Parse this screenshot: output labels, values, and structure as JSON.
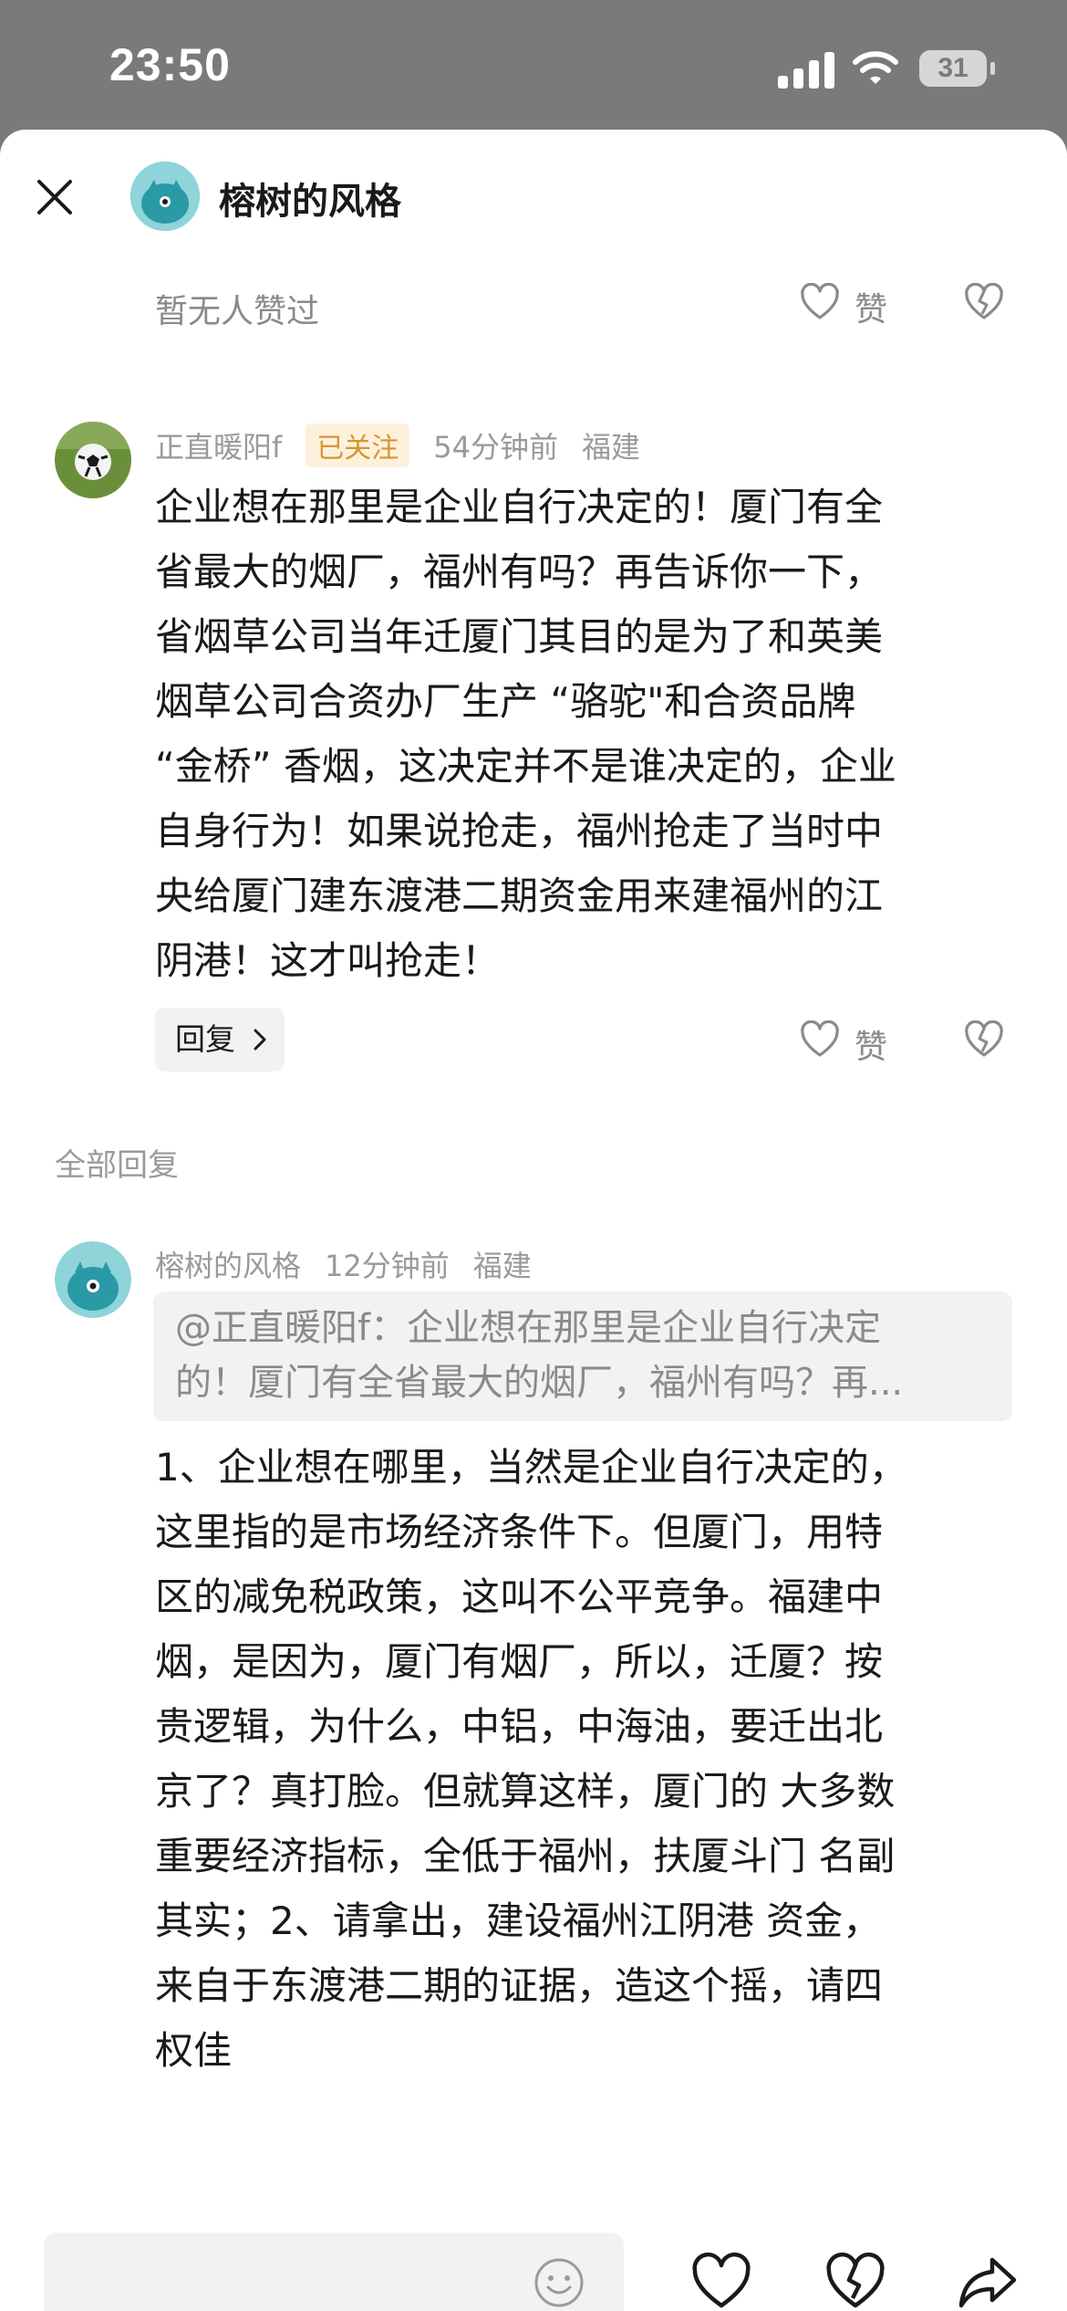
{
  "status_bar": {
    "time": "23:50",
    "battery": "31"
  },
  "header": {
    "title": "榕树的风格"
  },
  "likes_row": {
    "text": "暂无人赞过",
    "like_label": "赞"
  },
  "comment": {
    "username": "正直暖阳f",
    "follow_badge": "已关注",
    "time": "54分钟前",
    "location": "福建",
    "lines": [
      "企业想在那里是企业自行决定的！厦门有全",
      "省最大的烟厂，福州有吗？再告诉你一下，",
      "省烟草公司当年迁厦门其目的是为了和英美",
      "烟草公司合资办厂生产 “骆驼\"和合资品牌",
      "“金桥” 香烟，这决定并不是谁决定的，企业",
      "自身行为！如果说抢走，福州抢走了当时中",
      "央给厦门建东渡港二期资金用来建福州的江",
      "阴港！这才叫抢走！"
    ],
    "reply_label": "回复",
    "like_label": "赞"
  },
  "all_replies_label": "全部回复",
  "reply": {
    "username": "榕树的风格",
    "time": "12分钟前",
    "location": "福建",
    "quote_lines": [
      "@正直暖阳f：企业想在那里是企业自行决定",
      "的！厦门有全省最大的烟厂，福州有吗？再..."
    ],
    "lines": [
      "1、企业想在哪里，当然是企业自行决定的，",
      "这里指的是市场经济条件下。但厦门，用特",
      "区的减免税政策，这叫不公平竞争。福建中",
      "烟，是因为，厦门有烟厂，所以，迁厦？按",
      "贵逻辑，为什么，中铝，中海油，要迁出北",
      "京了？真打脸。但就算这样，厦门的 大多数",
      "重要经济指标，全低于福州，扶厦斗门 名副",
      "其实；2、请拿出，建设福州江阴港 资金，",
      "来自于东渡港二期的证据，造这个摇，请四",
      "权佳"
    ]
  },
  "icons": {
    "close": "close-icon",
    "like": "heart-outline-icon",
    "dislike": "broken-heart-icon",
    "emoji": "smiley-icon",
    "share": "share-arrow-icon"
  },
  "colors": {
    "follow_badge_text": "#d8952f",
    "follow_badge_bg": "#fdf1dc",
    "avatar_teal": "#4bb3bd"
  }
}
